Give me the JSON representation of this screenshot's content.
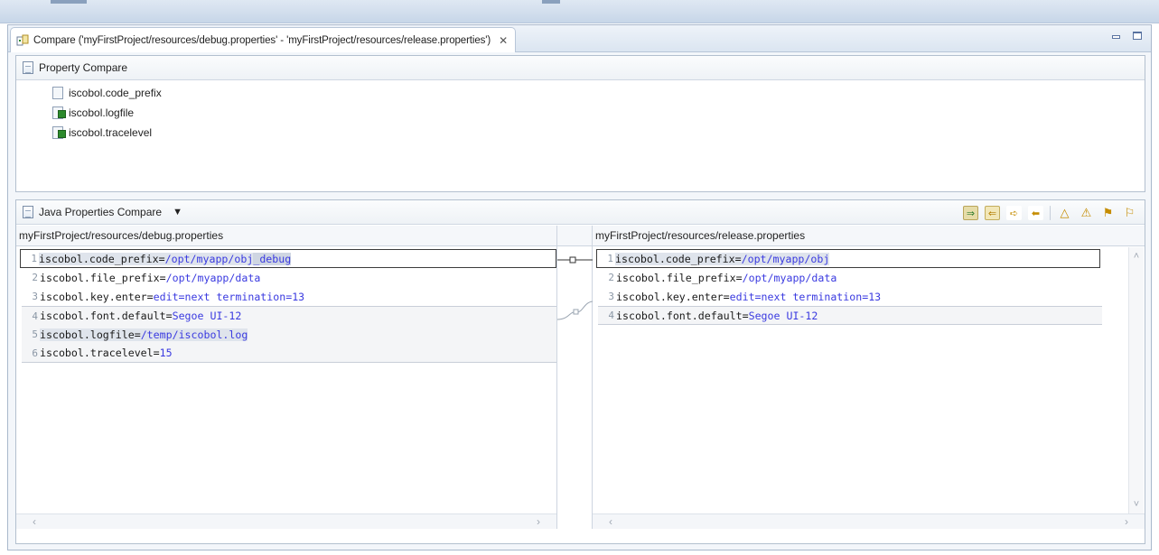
{
  "editor_tab": {
    "title": "Compare ('myFirstProject/resources/debug.properties' - 'myFirstProject/resources/release.properties')",
    "close_glyph": "✕"
  },
  "property_compare": {
    "title": "Property Compare",
    "items": [
      {
        "label": "iscobol.code_prefix",
        "icon": "properties-file-icon"
      },
      {
        "label": "iscobol.logfile",
        "icon": "properties-added-icon"
      },
      {
        "label": "iscobol.tracelevel",
        "icon": "properties-added-icon"
      }
    ]
  },
  "java_compare": {
    "title": "Java Properties Compare",
    "dropdown_glyph": "▼"
  },
  "left": {
    "path": "myFirstProject/resources/debug.properties",
    "lines": [
      {
        "n": "1",
        "key": "iscobol.code_prefix=",
        "val": "/opt/myapp/obj",
        "extra": "_debug"
      },
      {
        "n": "2",
        "key": "iscobol.file_prefix=",
        "val": "/opt/myapp/data",
        "extra": ""
      },
      {
        "n": "3",
        "key": "iscobol.key.enter=",
        "val": "edit=next termination=13",
        "extra": ""
      },
      {
        "n": "4",
        "key": "iscobol.font.default=",
        "val": "Segoe UI-12",
        "extra": ""
      },
      {
        "n": "5",
        "key": "iscobol.logfile=",
        "val": "/temp/iscobol.log",
        "extra": ""
      },
      {
        "n": "6",
        "key": "iscobol.tracelevel=",
        "val": "15",
        "extra": ""
      }
    ]
  },
  "right": {
    "path": "myFirstProject/resources/release.properties",
    "lines": [
      {
        "n": "1",
        "key": "iscobol.code_prefix=",
        "val": "/opt/myapp/obj"
      },
      {
        "n": "2",
        "key": "iscobol.file_prefix=",
        "val": "/opt/myapp/data"
      },
      {
        "n": "3",
        "key": "iscobol.key.enter=",
        "val": "edit=next termination=13"
      },
      {
        "n": "4",
        "key": "iscobol.font.default=",
        "val": "Segoe UI-12"
      }
    ]
  },
  "scroll": {
    "left": "‹",
    "right": "›",
    "up": "˄",
    "down": "˅"
  },
  "colors": {
    "value_text": "#3a3ae0",
    "border": "#b3c0cf",
    "header_bg": "#dbe5f1"
  }
}
